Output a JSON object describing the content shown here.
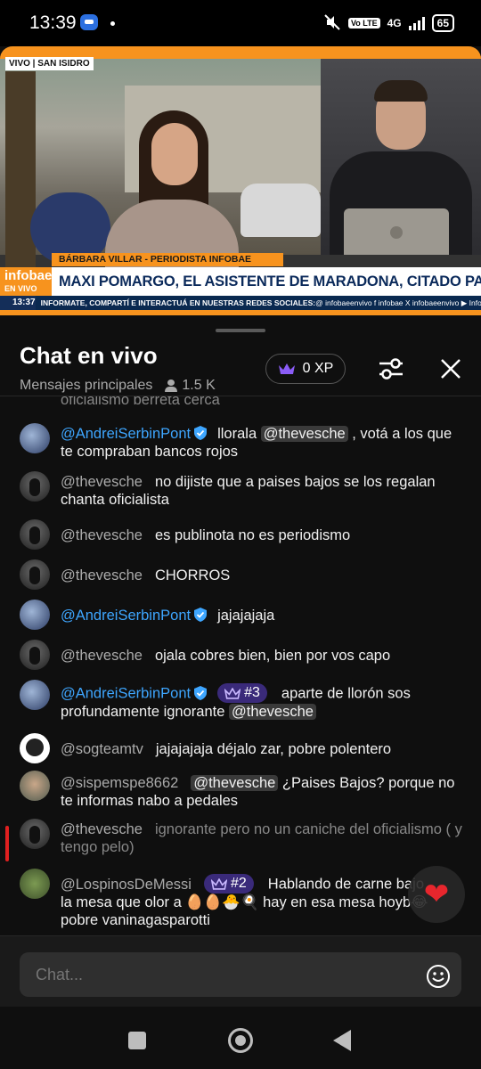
{
  "status_bar": {
    "time": "13:39",
    "network": "4G",
    "volte": "Vo LTE",
    "battery": "65"
  },
  "video": {
    "live_tag": "VIVO | SAN ISIDRO",
    "reporter": "BÁRBARA VILLAR - PERIODISTA INFOBAE",
    "logo": "infobae",
    "logo_sub": "EN VIVO",
    "headline": "MAXI POMARGO, EL ASISTENTE DE MARADONA, CITADO PARA ESTA TARDE",
    "ticker_time": "13:37",
    "ticker_text": "INFORMATE, COMPARTÍ E INTERACTUÁ EN NUESTRAS REDES SOCIALES:",
    "ticker_social": "@ infobaeenvivo   f infobae   X infobaeenvivo   ▶ Infobae",
    "progress": 1.0,
    "accent_color": "#f7931e"
  },
  "chat": {
    "title": "Chat en vivo",
    "subtitle": "Mensajes principales",
    "viewers": "1.5 K",
    "xp": "0 XP",
    "truncated_top": "oficialismo berreta cerca"
  },
  "messages": [
    {
      "author": "@AndreiSerbinPont",
      "verified": true,
      "mod": true,
      "parts": [
        "llorala ",
        "@thevesche",
        " , votá a los que te compraban bancos rojos"
      ]
    },
    {
      "author": "@thevesche",
      "text": "no dijiste que a paises bajos se los regalan chanta oficialista"
    },
    {
      "author": "@thevesche",
      "text": "es publinota no es periodismo"
    },
    {
      "author": "@thevesche",
      "text": "CHORROS"
    },
    {
      "author": "@AndreiSerbinPont",
      "verified": true,
      "text": "jajajajaja"
    },
    {
      "author": "@thevesche",
      "text": "ojala cobres bien, bien por vos capo"
    },
    {
      "author": "@AndreiSerbinPont",
      "verified": true,
      "rank": "#3",
      "text": "aparte de llorón sos profundamente ignorante",
      "mention": "@thevesche"
    },
    {
      "author": "@sogteamtv",
      "text": "jajajajaja déjalo zar, pobre polentero"
    },
    {
      "author": "@sispemspe8662",
      "mention": "@thevesche",
      "text": "¿Paises Bajos? porque no te informas nabo a pedales"
    },
    {
      "author": "@thevesche",
      "text": "ignorante pero no un caniche del oficialismo ( y tengo pelo)",
      "dimmed": true
    },
    {
      "author": "@LospinosDeMessi",
      "rank": "#2",
      "text": "Hablando de carne bajo la mesa que olor a 🥚🥚🐣🍳 hay en esa mesa hoyb😂 pobre vaninagasparotti"
    }
  ],
  "input": {
    "placeholder": "Chat..."
  },
  "reaction_icon": "heart-icon"
}
